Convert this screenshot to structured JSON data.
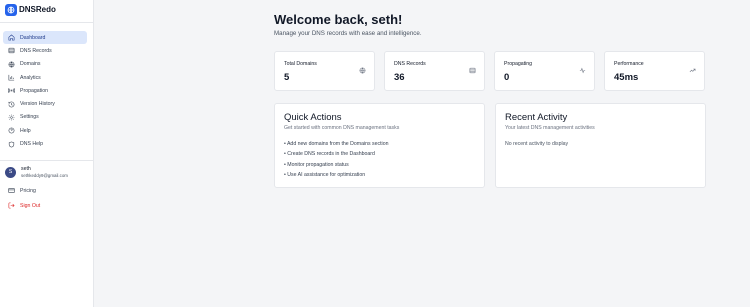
{
  "brand": {
    "name": "DNSRedo"
  },
  "sidebar": {
    "items": [
      {
        "label": "Dashboard",
        "icon": "home-icon",
        "active": true
      },
      {
        "label": "DNS Records",
        "icon": "database-icon"
      },
      {
        "label": "Domains",
        "icon": "globe-icon"
      },
      {
        "label": "Analytics",
        "icon": "bar-chart-icon"
      },
      {
        "label": "Propagation",
        "icon": "radio-icon"
      },
      {
        "label": "Version History",
        "icon": "history-icon"
      },
      {
        "label": "Settings",
        "icon": "gear-icon"
      },
      {
        "label": "Help",
        "icon": "help-circle-icon"
      },
      {
        "label": "DNS Help",
        "icon": "shield-icon"
      }
    ],
    "user": {
      "initial": "S",
      "name": "seth",
      "email": "sethkeddy9@gmail.com"
    },
    "pricing_label": "Pricing",
    "signout_label": "Sign Out"
  },
  "main": {
    "welcome": "Welcome back, seth!",
    "subtitle": "Manage your DNS records with ease and intelligence.",
    "stats": [
      {
        "label": "Total Domains",
        "value": "5",
        "icon": "globe-icon"
      },
      {
        "label": "DNS Records",
        "value": "36",
        "icon": "database-icon"
      },
      {
        "label": "Propagating",
        "value": "0",
        "icon": "activity-icon"
      },
      {
        "label": "Performance",
        "value": "45ms",
        "icon": "trending-up-icon"
      }
    ],
    "quick_actions": {
      "title": "Quick Actions",
      "subtitle": "Get started with common DNS management tasks",
      "items": [
        "• Add new domains from the Domains section",
        "• Create DNS records in the Dashboard",
        "• Monitor propagation status",
        "• Use AI assistance for optimization"
      ]
    },
    "recent_activity": {
      "title": "Recent Activity",
      "subtitle": "Your latest DNS management activities",
      "empty": "No recent activity to display"
    }
  },
  "colors": {
    "accent": "#2563eb",
    "active_bg": "#dbe6fb",
    "danger": "#dc2626",
    "avatar": "#3b4a86"
  }
}
